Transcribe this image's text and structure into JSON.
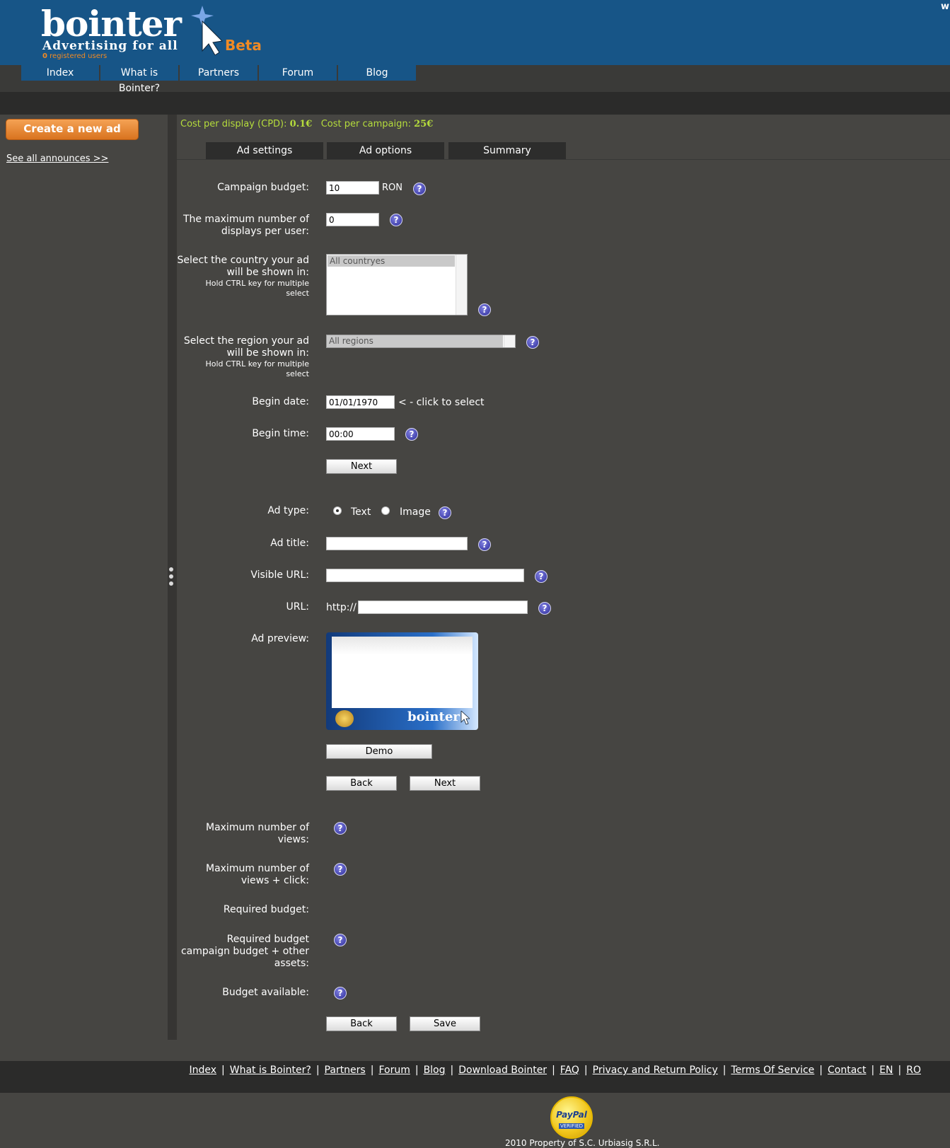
{
  "header": {
    "logo_word": "bointer",
    "logo_tagline": "Advertising for all",
    "registered_count": "0",
    "registered_label": "registered users",
    "beta": "Beta",
    "corner_letter": "w"
  },
  "nav": {
    "items": [
      "Index",
      "What is Bointer?",
      "Partners",
      "Forum",
      "Blog"
    ]
  },
  "sidebar": {
    "create_button": "Create a new ad",
    "see_all": "See all announces >>"
  },
  "costs": {
    "cpd_label": "Cost per display (CPD):",
    "cpd_value": "0.1€",
    "campaign_label": "Cost per campaign:",
    "campaign_value": "25€"
  },
  "tabs": [
    "Ad settings",
    "Ad options",
    "Summary"
  ],
  "settings": {
    "budget_label": "Campaign budget:",
    "budget_value": "10",
    "budget_currency": "RON",
    "max_displays_label_1": "The maximum number of",
    "max_displays_label_2": "displays per user:",
    "max_displays_value": "0",
    "country_label_1": "Select the country your ad",
    "country_label_2": "will be shown in:",
    "country_hint_1": "Hold CTRL key for multiple",
    "country_hint_2": "select",
    "country_option": "All countryes",
    "region_label_1": "Select the region your ad",
    "region_label_2": "will be shown in:",
    "region_hint_1": "Hold CTRL key for multiple",
    "region_hint_2": "select",
    "region_option": "All regions",
    "begin_date_label": "Begin date:",
    "begin_date_value": "01/01/1970",
    "begin_date_hint": "< - click to select",
    "begin_time_label": "Begin time:",
    "begin_time_value": "00:00",
    "next": "Next"
  },
  "options": {
    "ad_type_label": "Ad type:",
    "type_text": "Text",
    "type_image": "Image",
    "ad_title_label": "Ad title:",
    "visible_url_label": "Visible URL:",
    "url_label": "URL:",
    "url_prefix": "http://",
    "preview_label": "Ad preview:",
    "preview_brand": "bointer",
    "demo": "Demo",
    "back": "Back",
    "next": "Next"
  },
  "summary": {
    "max_views_1": "Maximum number of",
    "max_views_2": "views:",
    "max_views_click_1": "Maximum number of",
    "max_views_click_2": "views + click:",
    "required_budget": "Required budget:",
    "required_budget_campaign_1": "Required budget",
    "required_budget_campaign_2": "campaign budget + other",
    "required_budget_campaign_3": "assets:",
    "budget_available": "Budget available:",
    "back": "Back",
    "save": "Save"
  },
  "footer": {
    "links": [
      "Index",
      "What is Bointer?",
      "Partners",
      "Forum",
      "Blog",
      "Download Bointer",
      "FAQ",
      "Privacy and Return Policy",
      "Terms Of Service",
      "Contact",
      "EN",
      "RO"
    ],
    "paypal_1": "PayPal",
    "paypal_2": "VERIFIED",
    "copyright": "2010 Property of S.C. Urbiasig S.R.L."
  },
  "colors": {
    "header_blue": "#175587",
    "accent_orange": "#f08a24",
    "cost_green": "#b5dc3c",
    "background": "#464542"
  }
}
